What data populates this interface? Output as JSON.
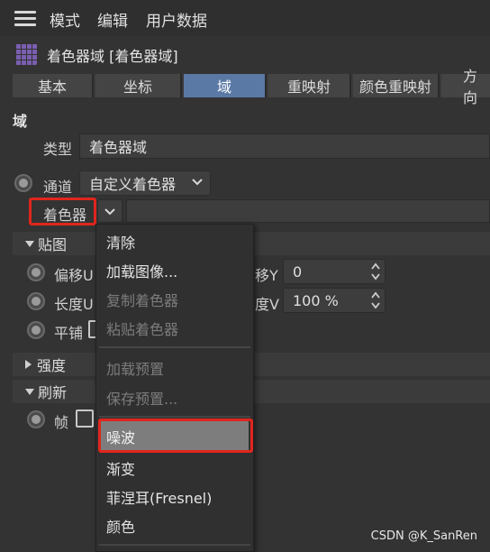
{
  "menubar": {
    "items": [
      "模式",
      "编辑",
      "用户数据"
    ]
  },
  "title": {
    "text": "着色器域 [着色器域]"
  },
  "tabs": [
    "基本",
    "坐标",
    "域",
    "重映射",
    "颜色重映射",
    "方向"
  ],
  "active_tab": "域",
  "section": {
    "heading": "域",
    "type_label": "类型",
    "type_value": "着色器域",
    "channel_label": "通道",
    "channel_value": "自定义着色器",
    "shader_label": "着色器"
  },
  "groups": {
    "texture": "贴图",
    "strength": "强度",
    "refresh": "刷新"
  },
  "texture_rows": {
    "offset_u_label": "偏移U",
    "offset_y_label": "移Y",
    "offset_y_value": "0",
    "length_u_label": "长度U",
    "length_v_label": "度V",
    "length_v_value": "100 %",
    "tile_label": "平铺"
  },
  "refresh_rows": {
    "frame_label": "帧"
  },
  "popup": {
    "items": [
      {
        "label": "清除",
        "enabled": true
      },
      {
        "label": "加载图像...",
        "enabled": true
      },
      {
        "label": "复制着色器",
        "enabled": false
      },
      {
        "label": "粘贴着色器",
        "enabled": false
      },
      {
        "label": "加载预置",
        "enabled": false
      },
      {
        "label": "保存预置...",
        "enabled": false
      },
      {
        "label": "噪波",
        "enabled": true,
        "highlighted": true
      },
      {
        "label": "渐变",
        "enabled": true
      },
      {
        "label": "菲涅耳(Fresnel)",
        "enabled": true
      },
      {
        "label": "颜色",
        "enabled": true
      }
    ]
  },
  "watermark": "CSDN @K_SanRen",
  "colors": {
    "accent_tab": "#5a79a5",
    "annotation_red": "#e0261c",
    "menu_highlight": "#7d7d7d"
  }
}
